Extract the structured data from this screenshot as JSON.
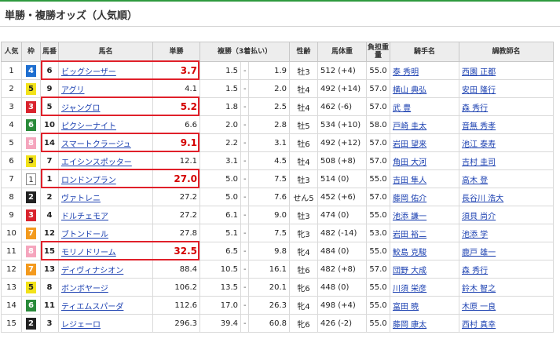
{
  "title": "単勝・複勝オッズ（人気順）",
  "headers": {
    "ninki": "人気",
    "waku": "枠",
    "umaban": "馬番",
    "bamei": "馬名",
    "tansho": "単勝",
    "fukusho": "複勝（3着払い）",
    "seirei": "性齢",
    "bataiju": "馬体重",
    "futan": "負担重量",
    "kishu": "騎手名",
    "chokyoshi": "調教師名"
  },
  "rows": [
    {
      "ninki": "1",
      "waku": "4",
      "umaban": "6",
      "bamei": "ビッグシーザー",
      "tansho": "3.7",
      "fuku_lo": "1.5",
      "fuku_hi": "1.9",
      "seirei": "牡3",
      "bataiju": "512 (+4)",
      "futan": "55.0",
      "kishu": "泰 秀明",
      "chokyoshi": "西園 正都",
      "highlight": true
    },
    {
      "ninki": "2",
      "waku": "5",
      "umaban": "9",
      "bamei": "アグリ",
      "tansho": "4.1",
      "fuku_lo": "1.5",
      "fuku_hi": "2.0",
      "seirei": "牡4",
      "bataiju": "492 (+14)",
      "futan": "57.0",
      "kishu": "横山 典弘",
      "chokyoshi": "安田 隆行",
      "highlight": false
    },
    {
      "ninki": "3",
      "waku": "3",
      "umaban": "5",
      "bamei": "ジャングロ",
      "tansho": "5.2",
      "fuku_lo": "1.8",
      "fuku_hi": "2.5",
      "seirei": "牡4",
      "bataiju": "462 (-6)",
      "futan": "57.0",
      "kishu": "武 豊",
      "chokyoshi": "森 秀行",
      "highlight": true
    },
    {
      "ninki": "4",
      "waku": "6",
      "umaban": "10",
      "bamei": "ピクシーナイト",
      "tansho": "6.6",
      "fuku_lo": "2.0",
      "fuku_hi": "2.8",
      "seirei": "牡5",
      "bataiju": "534 (+10)",
      "futan": "58.0",
      "kishu": "戸崎 圭太",
      "chokyoshi": "音無 秀孝",
      "highlight": false
    },
    {
      "ninki": "5",
      "waku": "8",
      "umaban": "14",
      "bamei": "スマートクラージュ",
      "tansho": "9.1",
      "fuku_lo": "2.2",
      "fuku_hi": "3.1",
      "seirei": "牡6",
      "bataiju": "492 (+12)",
      "futan": "57.0",
      "kishu": "岩田 望来",
      "chokyoshi": "池江 泰寿",
      "highlight": true
    },
    {
      "ninki": "6",
      "waku": "5",
      "umaban": "7",
      "bamei": "エイシンスポッター",
      "tansho": "12.1",
      "fuku_lo": "3.1",
      "fuku_hi": "4.5",
      "seirei": "牡4",
      "bataiju": "508 (+8)",
      "futan": "57.0",
      "kishu": "角田 大河",
      "chokyoshi": "吉村 圭司",
      "highlight": false
    },
    {
      "ninki": "7",
      "waku": "1",
      "umaban": "1",
      "bamei": "ロンドンプラン",
      "tansho": "27.0",
      "fuku_lo": "5.0",
      "fuku_hi": "7.5",
      "seirei": "牡3",
      "bataiju": "514 (0)",
      "futan": "55.0",
      "kishu": "吉田 隼人",
      "chokyoshi": "高木 登",
      "highlight": true
    },
    {
      "ninki": "8",
      "waku": "2",
      "umaban": "2",
      "bamei": "ヴァトレニ",
      "tansho": "27.2",
      "fuku_lo": "5.0",
      "fuku_hi": "7.6",
      "seirei": "せん5",
      "bataiju": "452 (+6)",
      "futan": "57.0",
      "kishu": "藤岡 佑介",
      "chokyoshi": "長谷川 浩大",
      "highlight": false
    },
    {
      "ninki": "9",
      "waku": "3",
      "umaban": "4",
      "bamei": "ドルチェモア",
      "tansho": "27.2",
      "fuku_lo": "6.1",
      "fuku_hi": "9.0",
      "seirei": "牡3",
      "bataiju": "474 (0)",
      "futan": "55.0",
      "kishu": "池添 謙一",
      "chokyoshi": "須貝 尚介",
      "highlight": false
    },
    {
      "ninki": "10",
      "waku": "7",
      "umaban": "12",
      "bamei": "ブトンドール",
      "tansho": "27.8",
      "fuku_lo": "5.1",
      "fuku_hi": "7.5",
      "seirei": "牝3",
      "bataiju": "482 (-14)",
      "futan": "53.0",
      "kishu": "岩田 裕二",
      "chokyoshi": "池添 学",
      "highlight": false
    },
    {
      "ninki": "11",
      "waku": "8",
      "umaban": "15",
      "bamei": "モリノドリーム",
      "tansho": "32.5",
      "fuku_lo": "6.5",
      "fuku_hi": "9.8",
      "seirei": "牝4",
      "bataiju": "484 (0)",
      "futan": "55.0",
      "kishu": "鮫島 克駿",
      "chokyoshi": "鹿戸 雄一",
      "highlight": true
    },
    {
      "ninki": "12",
      "waku": "7",
      "umaban": "13",
      "bamei": "ディヴィナシオン",
      "tansho": "88.4",
      "fuku_lo": "10.5",
      "fuku_hi": "16.1",
      "seirei": "牡6",
      "bataiju": "482 (+8)",
      "futan": "57.0",
      "kishu": "団野 大成",
      "chokyoshi": "森 秀行",
      "highlight": false
    },
    {
      "ninki": "13",
      "waku": "5",
      "umaban": "8",
      "bamei": "ボンボヤージ",
      "tansho": "106.2",
      "fuku_lo": "13.5",
      "fuku_hi": "20.1",
      "seirei": "牝6",
      "bataiju": "448 (0)",
      "futan": "55.0",
      "kishu": "川須 栄彦",
      "chokyoshi": "鈴木 智之",
      "highlight": false
    },
    {
      "ninki": "14",
      "waku": "6",
      "umaban": "11",
      "bamei": "ティエムスパーダ",
      "tansho": "112.6",
      "fuku_lo": "17.0",
      "fuku_hi": "26.3",
      "seirei": "牝4",
      "bataiju": "498 (+4)",
      "futan": "55.0",
      "kishu": "富田 暁",
      "chokyoshi": "木原 一良",
      "highlight": false
    },
    {
      "ninki": "15",
      "waku": "2",
      "umaban": "3",
      "bamei": "レジェーロ",
      "tansho": "296.3",
      "fuku_lo": "39.4",
      "fuku_hi": "60.8",
      "seirei": "牝6",
      "bataiju": "426 (-2)",
      "futan": "55.0",
      "kishu": "藤岡 康太",
      "chokyoshi": "西村 真幸",
      "highlight": false
    }
  ]
}
